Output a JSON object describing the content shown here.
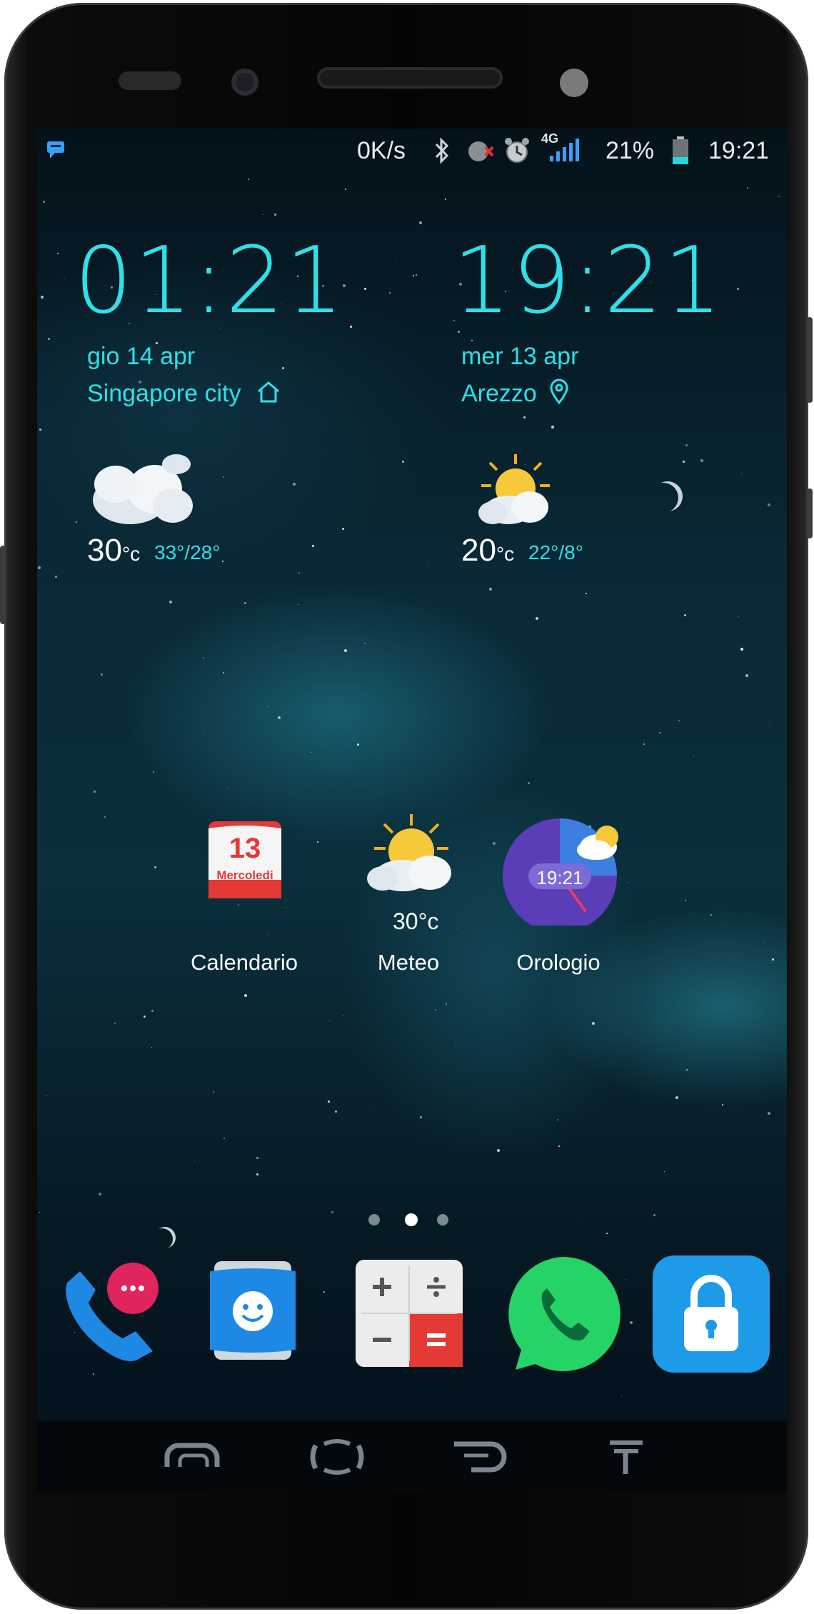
{
  "status_bar": {
    "network_speed": "0K/s",
    "network_type": "4G",
    "battery_percent": "21%",
    "time": "19:21",
    "icons": [
      "notification-icon",
      "bluetooth-icon",
      "mute-icon",
      "alarm-icon",
      "signal-icon",
      "battery-icon"
    ]
  },
  "widgets": {
    "left": {
      "time": "01:21",
      "date": "gio 14 apr",
      "city": "Singapore city",
      "temp": "30",
      "temp_unit": "°c",
      "range": "33°/28°",
      "icon": "cloudy-icon"
    },
    "right": {
      "time": "19:21",
      "date": "mer 13 apr",
      "city": "Arezzo",
      "temp": "20",
      "temp_unit": "°c",
      "range": "22°/8°",
      "icon": "partly-sunny-icon"
    }
  },
  "apps": [
    {
      "label": "Calendario",
      "icon": "calendar-icon",
      "day": "13",
      "weekday": "Mercoledi"
    },
    {
      "label": "Meteo",
      "icon": "weather-icon",
      "temp": "30°c"
    },
    {
      "label": "Orologio",
      "icon": "clock-icon",
      "time": "19:21"
    }
  ],
  "page_indicator": {
    "pages": 3,
    "active": 2
  },
  "dock": [
    {
      "name": "phone-icon"
    },
    {
      "name": "contacts-icon"
    },
    {
      "name": "calculator-icon"
    },
    {
      "name": "whatsapp-icon"
    },
    {
      "name": "lock-icon"
    }
  ],
  "nav": [
    "recent-apps-icon",
    "home-icon",
    "back-icon",
    "notification-pull-icon"
  ]
}
